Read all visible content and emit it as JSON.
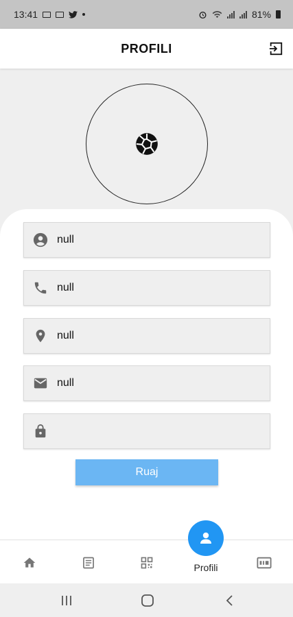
{
  "status_bar": {
    "time": "13:41",
    "battery": "81%"
  },
  "header": {
    "title": "PROFILI",
    "logout_icon": "logout-icon"
  },
  "avatar": {
    "icon": "camera-shutter-icon"
  },
  "fields": [
    {
      "icon": "person-icon",
      "value": "null",
      "placeholder": ""
    },
    {
      "icon": "phone-icon",
      "value": "null",
      "placeholder": ""
    },
    {
      "icon": "location-pin-icon",
      "value": "null",
      "placeholder": ""
    },
    {
      "icon": "mail-icon",
      "value": "null",
      "placeholder": ""
    },
    {
      "icon": "lock-icon",
      "value": "",
      "placeholder": ""
    }
  ],
  "save_button": {
    "label": "Ruaj",
    "color": "#6bb6f3"
  },
  "bottom_nav": {
    "items": [
      {
        "icon": "home-icon"
      },
      {
        "icon": "document-icon"
      },
      {
        "icon": "qr-code-icon"
      },
      {
        "icon": "person-icon",
        "label": "Profili",
        "active": true
      },
      {
        "icon": "card-icon"
      }
    ],
    "accent": "#2196f3"
  },
  "system_nav": {
    "icons": [
      "recents-icon",
      "home-circle-icon",
      "back-icon"
    ]
  }
}
